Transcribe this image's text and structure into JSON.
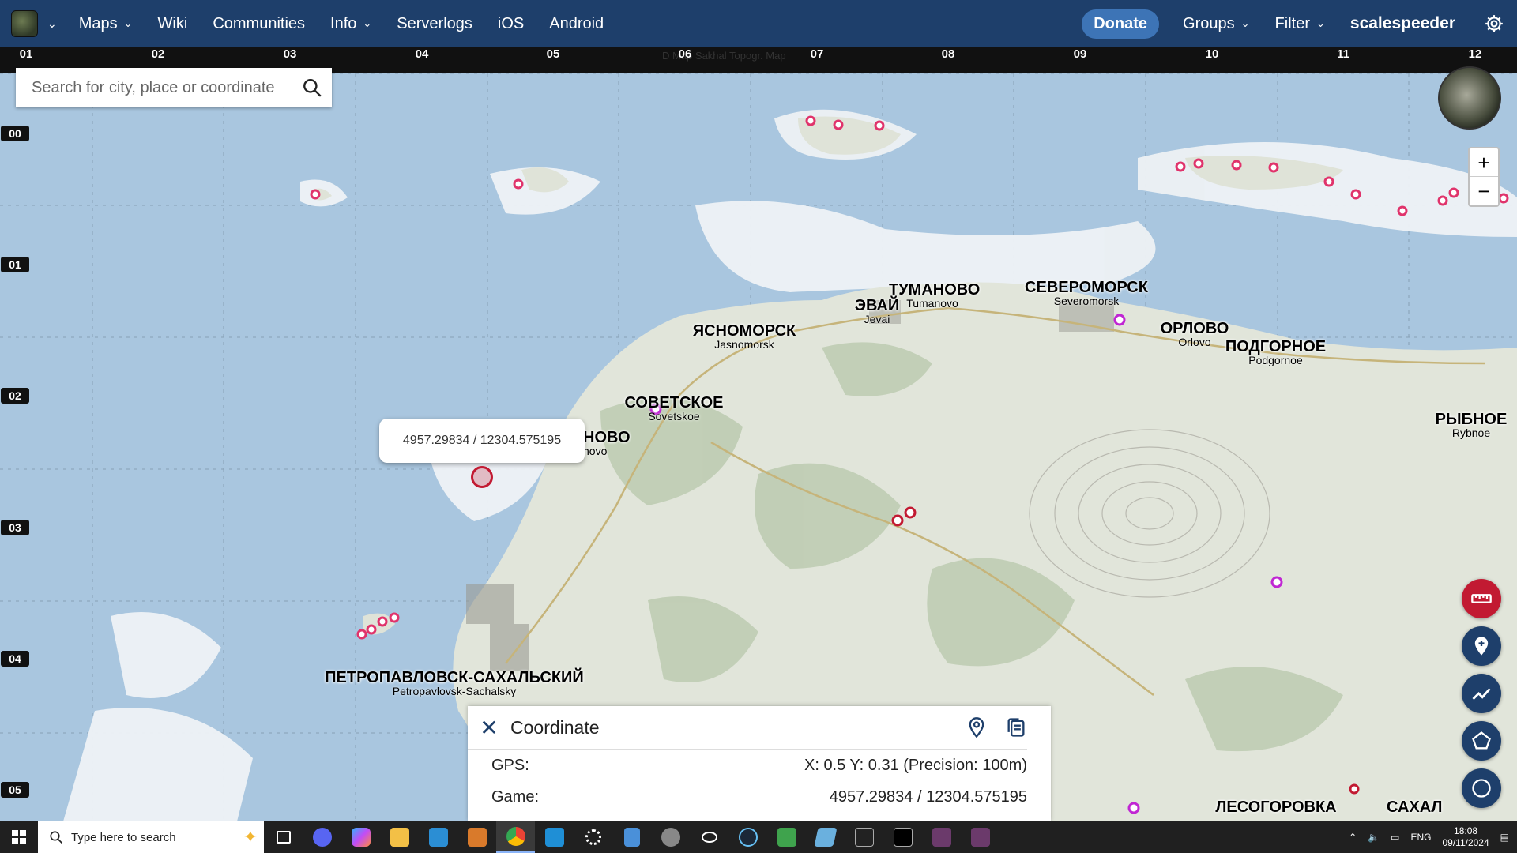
{
  "nav": {
    "logo_caret": "⌄",
    "items": [
      {
        "label": "Maps",
        "dropdown": true
      },
      {
        "label": "Wiki",
        "dropdown": false
      },
      {
        "label": "Communities",
        "dropdown": false
      },
      {
        "label": "Info",
        "dropdown": true
      },
      {
        "label": "Serverlogs",
        "dropdown": false
      },
      {
        "label": "iOS",
        "dropdown": false
      },
      {
        "label": "Android",
        "dropdown": false
      }
    ],
    "donate": "Donate",
    "groups": "Groups",
    "filter": "Filter",
    "username": "scalespeeder"
  },
  "grid": {
    "columns": [
      "01",
      "02",
      "03",
      "04",
      "05",
      "06",
      "07",
      "08",
      "09",
      "10",
      "11",
      "12"
    ],
    "rows": [
      "00",
      "01",
      "02",
      "03",
      "04",
      "05"
    ],
    "scale_text": "D     Map  Sakhal Topogr.        Map"
  },
  "search": {
    "placeholder": "Search for city, place or coordinate"
  },
  "zoom": {
    "in": "+",
    "out": "−"
  },
  "popup": {
    "text": "4957.29834 / 12304.575195"
  },
  "places": [
    {
      "ru": "ТУМАНОВО",
      "en": "Tumanovo"
    },
    {
      "ru": "СЕВЕРОМОРСК",
      "en": "Severomorsk"
    },
    {
      "ru": "ЭВАЙ",
      "en": "Jevai"
    },
    {
      "ru": "ЯСНОМОРСК",
      "en": "Jasnomorsk"
    },
    {
      "ru": "ОРЛОВО",
      "en": "Orlovo"
    },
    {
      "ru": "ПОДГОРНОЕ",
      "en": "Podgornoe"
    },
    {
      "ru": "СОВЕТСКОЕ",
      "en": "Sovetskoe"
    },
    {
      "ru": "НОВО",
      "en": "novo"
    },
    {
      "ru": "РЫБНОЕ",
      "en": "Rybnoe"
    },
    {
      "ru": "ПЕТРОПАВЛОВСК-САХАЛЬСКИЙ",
      "en": "Petropavlovsk-Sachalsky"
    },
    {
      "ru": "ЛЕСОГОРОВКА",
      "en": ""
    },
    {
      "ru": "САХАЛ",
      "en": ""
    }
  ],
  "panel": {
    "title": "Coordinate",
    "close": "✕",
    "gps_label": "GPS:",
    "gps_value": "X: 0.5 Y:  0.31 (Precision:  100m)",
    "game_label": "Game:",
    "game_value": "4957.29834 / 12304.575195"
  },
  "taskbar": {
    "search_placeholder": "Type here to search",
    "lang": "ENG",
    "time": "18:08",
    "date": "09/11/2024"
  },
  "colors": {
    "nav_bg": "#1e3f6b",
    "donate_bg": "#3d74b6",
    "accent_red": "#c21a32",
    "water": "#a9c6df",
    "land": "#e2e6dc"
  }
}
